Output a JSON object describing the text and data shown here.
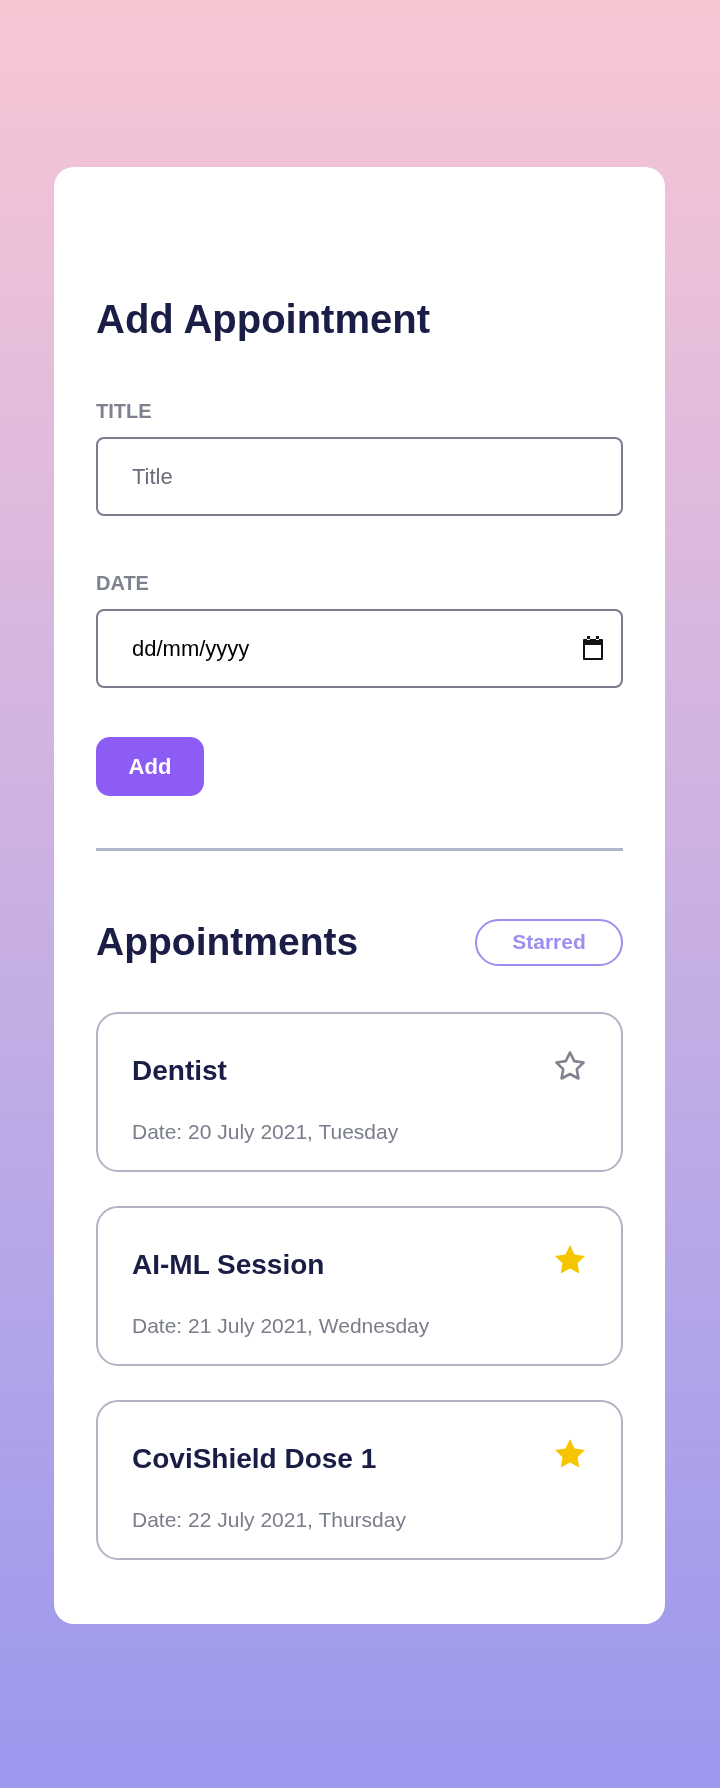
{
  "form": {
    "heading": "Add Appointment",
    "fields": [
      {
        "label": "TITLE",
        "placeholder": "Title",
        "kind": "text"
      },
      {
        "label": "DATE",
        "placeholder": "dd/mm/yyyy",
        "kind": "date"
      }
    ],
    "submit": "Add"
  },
  "list": {
    "heading": "Appointments",
    "filter": "Starred",
    "filter_selected": false,
    "items": [
      {
        "title": "Dentist",
        "date": "Date: 20 July 2021, Tuesday",
        "starred": false
      },
      {
        "title": "AI-ML Session",
        "date": "Date: 21 July 2021, Wednesday",
        "starred": true
      },
      {
        "title": "CoviShield Dose 1",
        "date": "Date: 22 July 2021, Thursday",
        "starred": true
      }
    ]
  }
}
